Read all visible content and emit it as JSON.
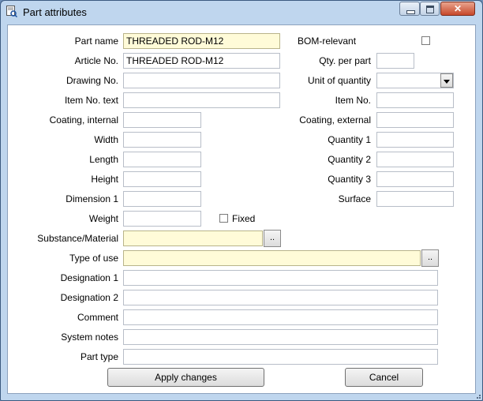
{
  "window": {
    "title": "Part attributes",
    "close_glyph": "✕"
  },
  "left": {
    "part_name": {
      "label": "Part name",
      "value": "THREADED ROD-M12"
    },
    "article_no": {
      "label": "Article No.",
      "value": "THREADED ROD-M12"
    },
    "drawing_no": {
      "label": "Drawing No.",
      "value": ""
    },
    "item_no_text": {
      "label": "Item No. text",
      "value": ""
    },
    "coating_internal": {
      "label": "Coating, internal",
      "value": ""
    },
    "width": {
      "label": "Width",
      "value": ""
    },
    "length": {
      "label": "Length",
      "value": ""
    },
    "height": {
      "label": "Height",
      "value": ""
    },
    "dimension1": {
      "label": "Dimension 1",
      "value": ""
    },
    "weight": {
      "label": "Weight",
      "value": ""
    },
    "fixed": {
      "label": "Fixed",
      "checked": false
    },
    "substance": {
      "label": "Substance/Material",
      "value": "",
      "button": ".."
    },
    "type_of_use": {
      "label": "Type of use",
      "value": "",
      "button": ".."
    },
    "designation1": {
      "label": "Designation 1",
      "value": ""
    },
    "designation2": {
      "label": "Designation 2",
      "value": ""
    },
    "comment": {
      "label": "Comment",
      "value": ""
    },
    "system_notes": {
      "label": "System notes",
      "value": ""
    },
    "part_type": {
      "label": "Part type",
      "value": ""
    }
  },
  "right": {
    "bom_relevant": {
      "label": "BOM-relevant",
      "checked": false
    },
    "qty_per_part": {
      "label": "Qty. per part",
      "value": ""
    },
    "unit_of_quantity": {
      "label": "Unit of quantity",
      "value": ""
    },
    "item_no": {
      "label": "Item No.",
      "value": ""
    },
    "coating_external": {
      "label": "Coating, external",
      "value": ""
    },
    "quantity1": {
      "label": "Quantity 1",
      "value": ""
    },
    "quantity2": {
      "label": "Quantity 2",
      "value": ""
    },
    "quantity3": {
      "label": "Quantity 3",
      "value": ""
    },
    "surface": {
      "label": "Surface",
      "value": ""
    }
  },
  "buttons": {
    "apply": "Apply changes",
    "cancel": "Cancel"
  },
  "colors": {
    "required_field_bg": "#fffbd8",
    "frame": "#bfd6ee",
    "close_button": "#c7482a"
  }
}
